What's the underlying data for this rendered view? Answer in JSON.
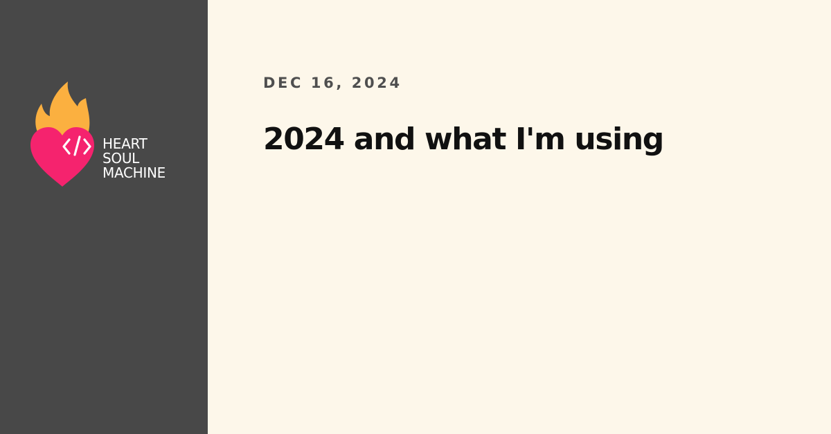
{
  "brand": {
    "icon": "flaming-heart-code-icon",
    "line1": "HEART",
    "line2": "SOUL",
    "line3": "MACHINE",
    "colors": {
      "flame": "#fbb040",
      "heart": "#f5236e",
      "sidebar": "#484848"
    }
  },
  "post": {
    "date": "DEC 16, 2024",
    "title": "2024 and what I'm using"
  },
  "colors": {
    "background": "#fdf7ea",
    "date_text": "#4f4f4f",
    "title_text": "#111111"
  }
}
